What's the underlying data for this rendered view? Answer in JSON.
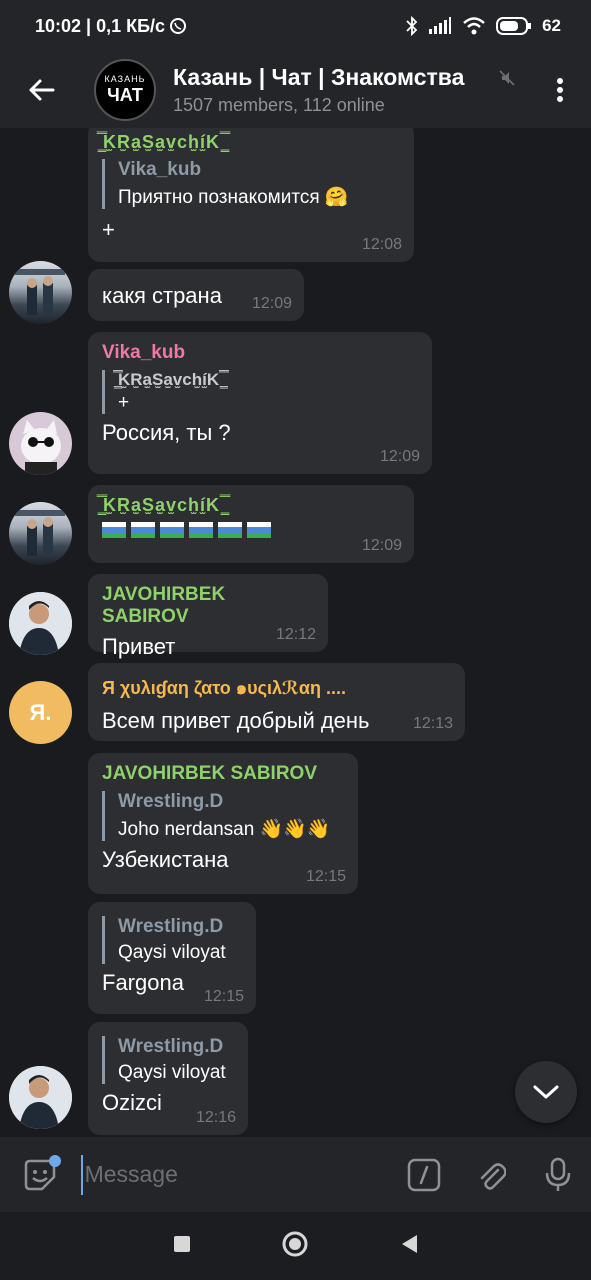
{
  "status": {
    "time_speed": "10:02 | 0,1 КБ/с",
    "battery": "62"
  },
  "header": {
    "avatar_top": "КАЗАНЬ",
    "avatar_bottom": "ЧАТ",
    "title": "Казань | Чат | Знакомства",
    "subtitle": "1507 members, 112 online"
  },
  "messages": [
    {
      "sender": "",
      "reply_name": "Vika_kub",
      "reply_text": "Приятно познакомится 🤗",
      "text": "+",
      "time": "12:08",
      "header_fancy": "͇̿̿̿̿̿K̫R̫a̫S̫a̫v̫ch̫í̫K ͇̿̿̿̿̿"
    },
    {
      "text": "какя страна",
      "time": "12:09"
    },
    {
      "sender": "Vika_kub",
      "reply_name": "͇̿̿̿̿̿K̫R̫a̫S̫a̫v̫ch̫í̫K ͇̿̿̿̿̿",
      "reply_text": "+",
      "text": "Россия, ты ?",
      "time": "12:09"
    },
    {
      "sender": "͇̿̿̿̿̿K̫R̫a̫S̫a̫v̫ch̫í̫K ͇̿̿̿̿̿",
      "time": "12:09",
      "flag_count": "6"
    },
    {
      "sender": "JAVOHIRBEK SABIROV",
      "text": "Привет",
      "time": "12:12"
    },
    {
      "sender": "Я χυλιɠαη ζατο ๑υςιλℛαη ....",
      "avatar_letter": "Я.",
      "text": "Всем привет добрый день",
      "time": "12:13"
    },
    {
      "sender": "JAVOHIRBEK SABIROV",
      "reply_name": "Wrestling.D",
      "reply_text": "Joho nerdansan 👋👋👋",
      "text": "Узбекистана",
      "time": "12:15"
    },
    {
      "reply_name": "Wrestling.D",
      "reply_text": "Qaysi viloyat",
      "text": "Fargona",
      "time": "12:15"
    },
    {
      "reply_name": "Wrestling.D",
      "reply_text": "Qaysi viloyat",
      "text": "Ozizci",
      "time": "12:16"
    }
  ],
  "composer": {
    "placeholder": "Message"
  },
  "colors": {
    "green_name": "#8fd16a",
    "pink_name": "#ee7aa1",
    "orange_name": "#f6b94e",
    "accent": "#6ea8e8"
  }
}
